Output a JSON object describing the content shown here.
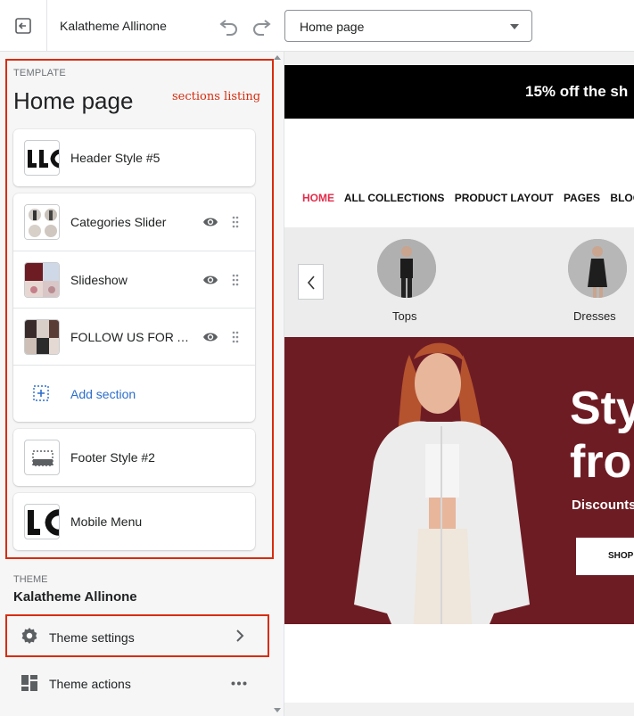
{
  "topbar": {
    "store_name": "Kalatheme Allinone",
    "page_selector_value": "Home page"
  },
  "sidebar": {
    "template_eyebrow": "TEMPLATE",
    "template_title": "Home page",
    "annotation": "sections listing",
    "header_section": {
      "label": "Header Style #5"
    },
    "sections": [
      {
        "label": "Categories Slider"
      },
      {
        "label": "Slideshow"
      },
      {
        "label": "FOLLOW US FOR AL..."
      }
    ],
    "add_section_label": "Add section",
    "footer_section": {
      "label": "Footer Style #2"
    },
    "mobile_section": {
      "label": "Mobile Menu"
    },
    "theme_eyebrow": "THEME",
    "theme_name": "Kalatheme Allinone",
    "theme_settings_label": "Theme settings",
    "theme_actions_label": "Theme actions"
  },
  "preview": {
    "announcement": "15% off the sh",
    "nav": [
      "HOME",
      "ALL COLLECTIONS",
      "PRODUCT LAYOUT",
      "PAGES",
      "BLOGS"
    ],
    "categories": [
      {
        "label": "Tops"
      },
      {
        "label": "Dresses"
      }
    ],
    "hero": {
      "title_line1": "Sty",
      "title_line2": "fro",
      "subtitle": "Discounts",
      "button_label": "SHOP"
    }
  },
  "colors": {
    "highlight": "#d82c0d",
    "accent_link": "#2c6ecb",
    "nav_active": "#e32c4b",
    "hero_bg": "#6e1c24"
  }
}
